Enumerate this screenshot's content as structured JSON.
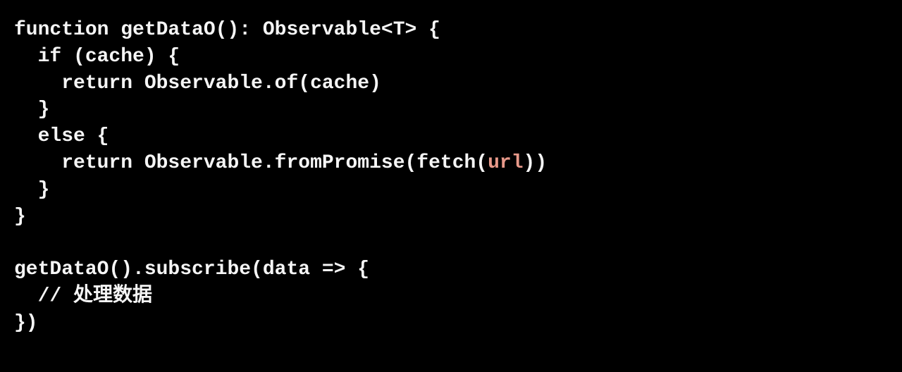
{
  "code": {
    "line1": "function getDataO(): Observable<T> {",
    "line2": "  if (cache) {",
    "line3": "    return Observable.of(cache)",
    "line4": "  }",
    "line5": "  else {",
    "line6a": "    return Observable.fromPromise(fetch(",
    "line6_url": "url",
    "line6b": "))",
    "line7": "  }",
    "line8": "}",
    "line9": "",
    "line10": "getDataO().subscribe(data => {",
    "line11": "  // 处理数据",
    "line12": "})"
  }
}
